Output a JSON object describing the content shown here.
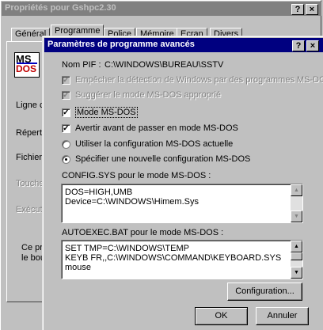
{
  "outer": {
    "title": "Propriétés pour Gshpc2.30",
    "tabs": [
      "Général",
      "Programme",
      "Police",
      "Mémoire",
      "Ecran",
      "Divers"
    ],
    "side_labels": [
      "Ligne c",
      "Répert",
      "Fichier",
      "Touche",
      "Exécut"
    ],
    "bottom_text": [
      "Ce pro",
      "le bou"
    ]
  },
  "icons": {
    "ms_dos_logo_text_top": "MS",
    "ms_dos_logo_text_bottom": "DOS"
  },
  "dialog": {
    "title": "Paramètres de programme avancés",
    "pif_label": "Nom PIF :",
    "pif_value": "C:\\WINDOWS\\BUREAU\\SSTV",
    "opt_prevent": "Empêcher la détection de Windows par des programmes MS-DOS",
    "opt_suggest": "Suggérer le mode MS-DOS approprié",
    "opt_msdos_mode": "Mode MS-DOS",
    "opt_warn": "Avertir avant de passer en mode MS-DOS",
    "opt_use_current": "Utiliser la configuration MS-DOS actuelle",
    "opt_specify_new": "Spécifier une nouvelle configuration MS-DOS",
    "config_label": "CONFIG.SYS pour le mode MS-DOS :",
    "config_text": "DOS=HIGH,UMB\nDevice=C:\\WINDOWS\\Himem.Sys",
    "autoexec_label": "AUTOEXEC.BAT pour le mode MS-DOS :",
    "autoexec_text": "SET TMP=C:\\WINDOWS\\TEMP\nKEYB FR,,C:\\WINDOWS\\COMMAND\\KEYBOARD.SYS\nmouse",
    "configuration_button": "Configuration...",
    "ok_button": "OK",
    "cancel_button": "Annuler",
    "checked": {
      "prevent": true,
      "suggest": true,
      "msdos_mode": true,
      "warn": true
    },
    "selected_radio": "specify_new"
  },
  "titlebar_buttons": {
    "help": "?",
    "close": "×"
  },
  "colors": {
    "active_title": "#000080",
    "inactive_title": "#808080",
    "face": "#c0c0c0"
  }
}
